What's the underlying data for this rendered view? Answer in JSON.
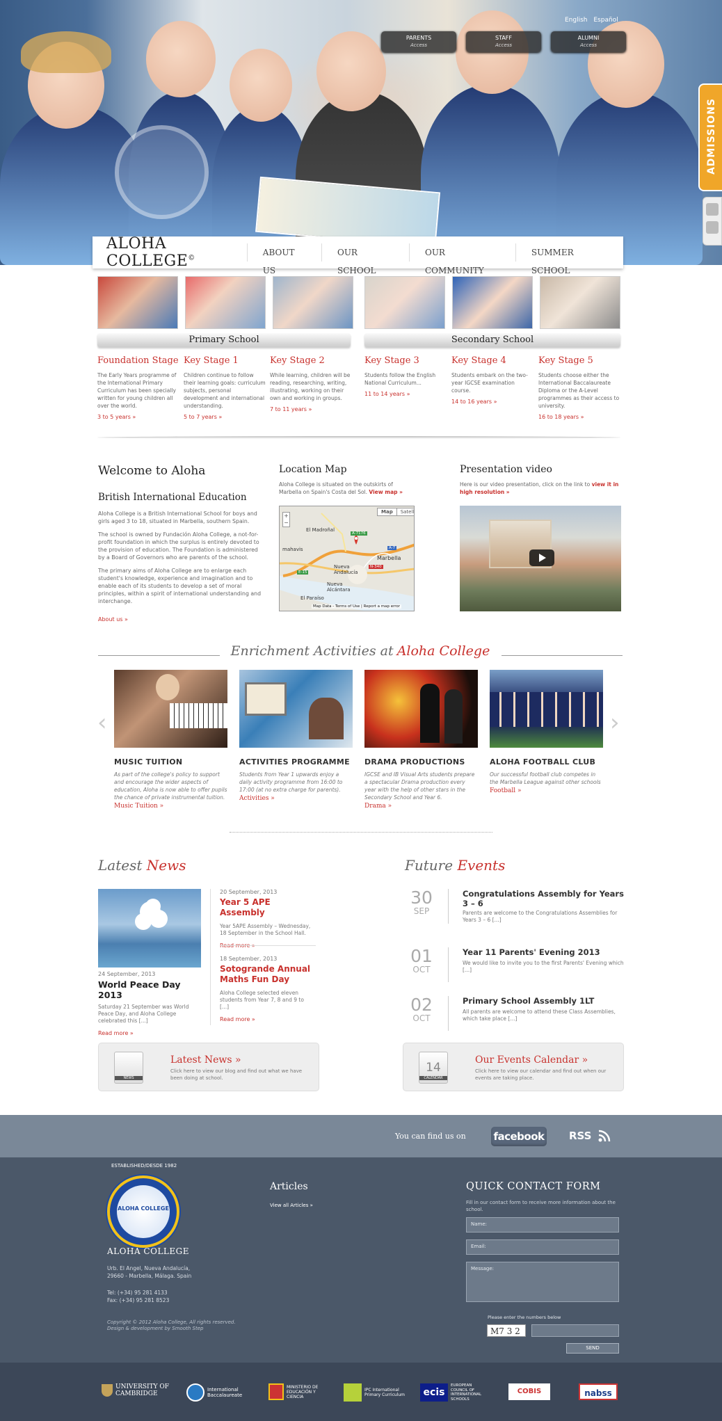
{
  "top": {
    "languages": [
      "English",
      "Español"
    ],
    "access": [
      {
        "label": "PARENTS",
        "sub": "Access"
      },
      {
        "label": "STAFF",
        "sub": "Access"
      },
      {
        "label": "ALUMNI",
        "sub": "Access"
      }
    ],
    "admissions": "ADMISSIONS"
  },
  "nav": {
    "logo": "ALOHA COLLEGE",
    "logo_mark": "©",
    "items": [
      "ABOUT US",
      "OUR SCHOOL",
      "OUR COMMUNITY",
      "SUMMER SCHOOL"
    ]
  },
  "stages": {
    "primary_label": "Primary School",
    "secondary_label": "Secondary School",
    "items": [
      {
        "title": "Foundation Stage",
        "text": "The Early Years programme of the International Primary Curriculum has been specially written for young children all over the world.",
        "age": "3 to 5 years »"
      },
      {
        "title": "Key Stage 1",
        "text": "Children continue to follow their learning goals: curriculum subjects, personal development and international understanding.",
        "age": "5 to 7 years »"
      },
      {
        "title": "Key Stage 2",
        "text": "While learning, children will be reading, researching, writing, illustrating, working on their own and working in groups.",
        "age": "7 to 11 years »"
      },
      {
        "title": "Key Stage 3",
        "text": "Students follow the English National Curriculum...",
        "age": "11 to 14 years »"
      },
      {
        "title": "Key Stage 4",
        "text": "Students embark on the two-year IGCSE examination course.",
        "age": "14 to 16 years »"
      },
      {
        "title": "Key Stage 5",
        "text": "Students choose either the International Baccalaureate Diploma or the A-Level programmes as their access to university.",
        "age": "16 to 18 years »"
      }
    ]
  },
  "welcome": {
    "title": "Welcome to Aloha",
    "subtitle": "British International Education",
    "p1": "Aloha College is a British International School for boys and girls aged 3 to 18, situated in Marbella, southern Spain.",
    "p2": "The school is owned by Fundación Aloha College, a not-for-profit foundation in which the surplus is entirely devoted to the provision of education. The Foundation is administered by a Board of Governors who are parents of the school.",
    "p3": "The primary aims of Aloha College are to enlarge each student's knowledge, experience and imagination and to enable each of its students to develop a set of moral principles, within a spirit of international understanding and interchange.",
    "link": "About us »"
  },
  "location": {
    "title": "Location Map",
    "text": "Aloha College is situated on the outskirts of Marbella on Spain's Costa del Sol.",
    "link": "View map »",
    "map_tabs": [
      "Map",
      "Satellite"
    ],
    "places": [
      "El Madroñal",
      "mahavis",
      "Nueva Andalucía",
      "Marbella",
      "Nueva Alcántara",
      "El Paraíso"
    ],
    "roads": [
      "A-7176",
      "E-15",
      "A-7",
      "N-340"
    ],
    "footer": [
      "Map Data",
      "Terms of Use",
      "Report a map error"
    ]
  },
  "video": {
    "title": "Presentation video",
    "text": "Here is our video presentation, click on the link to",
    "link": "view it in high resolution »"
  },
  "enrichment": {
    "title_a": "Enrichment Activities at",
    "title_b": "Aloha College",
    "items": [
      {
        "title": "MUSIC TUITION",
        "text": "As part of the college's policy to support and encourage the wider aspects of education, Aloha is now able to offer pupils the chance of private instrumental tuition.",
        "link": "Music Tuition »"
      },
      {
        "title": "ACTIVITIES PROGRAMME",
        "text": "Students from Year 1 upwards enjoy a daily activity programme from 16:00 to 17:00 (at no extra charge for parents).",
        "link": "Activities »"
      },
      {
        "title": "DRAMA PRODUCTIONS",
        "text": "IGCSE and IB Visual Arts students prepare a spectacular Drama production every year with the help of other stars in the Secondary School and Year 6.",
        "link": "Drama »"
      },
      {
        "title": "ALOHA FOOTBALL CLUB",
        "text": "Our successful football club competes in the Marbella League against other schools",
        "link": "Football »"
      }
    ]
  },
  "news": {
    "title_a": "Latest",
    "title_b": "News",
    "main": {
      "date": "24 September, 2013",
      "title": "World Peace Day 2013",
      "text": "Saturday 21 September was World Peace Day, and Aloha College celebrated this [...]",
      "link": "Read more »"
    },
    "items": [
      {
        "date": "20 September, 2013",
        "title": "Year 5 APE Assembly",
        "text": "Year 5APE Assembly – Wednesday, 18 September in the School Hall.",
        "link": "Read more »"
      },
      {
        "date": "18 September, 2013",
        "title": "Sotogrande Annual Maths Fun Day",
        "text": "Aloha College selected eleven students from Year 7, 8 and 9 to [...]",
        "link": "Read more »"
      }
    ]
  },
  "events": {
    "title_a": "Future",
    "title_b": "Events",
    "items": [
      {
        "day": "30",
        "month": "SEP",
        "title": "Congratulations Assembly for Years 3 – 6",
        "text": "Parents are welcome to the Congratulations Assemblies for Years 3 – 6 [...]"
      },
      {
        "day": "01",
        "month": "OCT",
        "title": "Year 11 Parents' Evening 2013",
        "text": "We would like to invite you to the first Parents' Evening which [...]"
      },
      {
        "day": "02",
        "month": "OCT",
        "title": "Primary School Assembly 1LT",
        "text": "All parents are welcome to attend these Class Assemblies, which take place [...]"
      }
    ]
  },
  "cta": {
    "news": {
      "icon_label": "NEWS",
      "title": "Latest News »",
      "text": "Click here to view our blog and find out what we have been doing at school."
    },
    "events": {
      "icon_day": "14",
      "icon_label": "CALENDAR",
      "title": "Our Events Calendar »",
      "text": "Click here to view our calendar and find out when our events are taking place."
    }
  },
  "social": {
    "text": "You can find us on",
    "facebook": "facebook",
    "rss": "RSS"
  },
  "footer": {
    "seal_top": "ESTABLISHED/DESDE 1982",
    "seal_name": "ALOHA COLLEGE",
    "school": "ALOHA COLLEGE",
    "address1": "Urb. El Angel, Nueva Andalucía,",
    "address2": "29660 - Marbella, Málaga. Spain",
    "tel": "Tel:        (+34) 95 281 4133",
    "fax": "Fax:       (+34) 95 281 8523",
    "copy1": "Copyright © 2012 Aloha College, All rights reserved.",
    "copy2": "Design & development by Smooth Step",
    "articles_title": "Articles",
    "articles_link": "View all Articles »"
  },
  "contact": {
    "title": "QUICK CONTACT FORM",
    "desc": "Fill in our contact form to receive more information about the school.",
    "name": "Name:",
    "email": "Email:",
    "message": "Message:",
    "captcha_label": "Please enter the numbers below",
    "captcha": "M7 3 2",
    "send": "SEND"
  },
  "partners": [
    {
      "name": "UNIVERSITY OF CAMBRIDGE"
    },
    {
      "name": "International Baccalaureate"
    },
    {
      "name": "MINISTERIO DE EDUCACIÓN Y CIENCIA"
    },
    {
      "name": "IPC International Primary Curriculum"
    },
    {
      "name": "ecis",
      "sub": "EUROPEAN COUNCIL OF INTERNATIONAL SCHOOLS"
    },
    {
      "name": "COBIS"
    },
    {
      "name": "nabss"
    }
  ]
}
